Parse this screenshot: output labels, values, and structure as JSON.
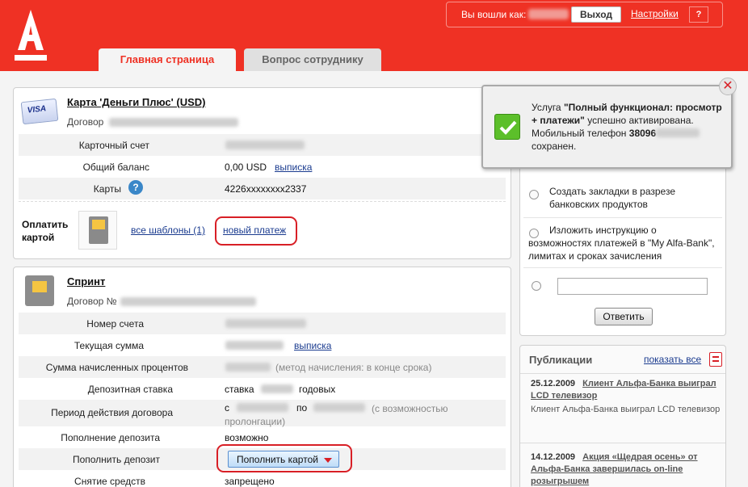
{
  "header": {
    "logged_in_as": "Вы вошли как:",
    "logout": "Выход",
    "settings": "Настройки",
    "help": "?",
    "tabs": [
      "Главная страница",
      "Вопрос сотруднику"
    ]
  },
  "card": {
    "title": "Карта 'Деньги Плюс' (USD)",
    "contract_label": "Договор",
    "rows": [
      {
        "label": "Карточный счет",
        "value": ""
      },
      {
        "label": "Общий баланс",
        "value": "0,00 USD",
        "link": "выписка"
      },
      {
        "label": "Карты",
        "value": "4226xxxxxxxx2337"
      }
    ],
    "pay_label": "Оплатить картой",
    "all_templates": "все шаблоны (1)",
    "new_payment": "новый платеж",
    "visa_text": "VISA"
  },
  "deposit": {
    "title": "Спринт",
    "contract_label": "Договор №",
    "rows": [
      {
        "label": "Номер счета"
      },
      {
        "label": "Текущая сумма",
        "link": "выписка"
      },
      {
        "label": "Сумма начисленных процентов",
        "note": "(метод начисления: в конце срока)"
      },
      {
        "label": "Депозитная ставка",
        "pre": "ставка",
        "post": "годовых"
      },
      {
        "label": "Период действия договора",
        "from": "с",
        "to": "по",
        "note": "(с возможностью пролонгации)"
      },
      {
        "label": "Пополнение депозита",
        "value": "возможно"
      },
      {
        "label": "Пополнить депозит",
        "button": "Пополнить картой"
      },
      {
        "label": "Снятие средств",
        "value": "запрещено"
      }
    ]
  },
  "notice": {
    "prefix": "Услуга",
    "bold": "\"Полный функционал: просмотр + платежи\"",
    "mid": "успешно активирована. Мобильный телефон",
    "phone": "38096",
    "suffix": "сохранен."
  },
  "survey": {
    "options": [
      "Создать закладки в разрезе банковских продуктов",
      "Изложить инструкцию о возможностях платежей в \"My Alfa-Bank\", лимитах и сроках зачисления"
    ],
    "answer_button": "Ответить"
  },
  "publications": {
    "title": "Публикации",
    "show_all": "показать все",
    "items": [
      {
        "date": "25.12.2009",
        "title": "Клиент Альфа-Банка выиграл LCD телевизор",
        "text": "Клиент Альфа-Банка выиграл LCD телевизор"
      },
      {
        "date": "14.12.2009",
        "title": "Акция «Щедрая осень» от Альфа-Банка завершилась on-line розыгрышем"
      }
    ]
  },
  "colors": {
    "brand_red": "#ef3124",
    "link_blue": "#1a3b8f",
    "success_green": "#5cbf2a"
  }
}
